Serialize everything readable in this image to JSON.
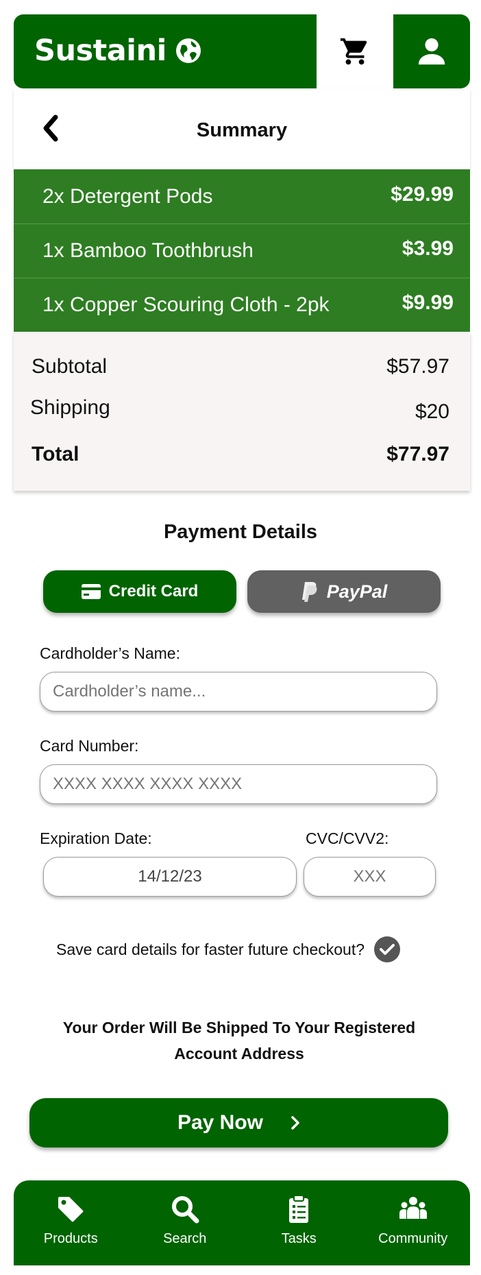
{
  "header": {
    "brand": "Sustaini",
    "brand_icon": "globe-icon",
    "cart_icon": "cart-icon",
    "profile_icon": "user-icon"
  },
  "summary": {
    "title": "Summary",
    "items": [
      {
        "name": "2x Detergent Pods",
        "price": "$29.99"
      },
      {
        "name": "1x Bamboo Toothbrush",
        "price": "$3.99"
      },
      {
        "name": "1x Copper Scouring Cloth - 2pk",
        "price": "$9.99"
      }
    ],
    "subtotal_label": "Subtotal",
    "subtotal_value": "$57.97",
    "shipping_label": "Shipping",
    "shipping_value": "$20",
    "total_label": "Total",
    "total_value": "$77.97"
  },
  "payment": {
    "title": "Payment Details",
    "credit_card_label": "Credit Card",
    "paypal_label": "PayPal",
    "cardholder_label": "Cardholder’s Name:",
    "cardholder_placeholder": "Cardholder’s name...",
    "card_number_label": "Card Number:",
    "card_number_placeholder": "XXXX XXXX XXXX XXXX",
    "expiry_label": "Expiration Date:",
    "expiry_value": "14/12/23",
    "cvc_label": "CVC/CVV2:",
    "cvc_placeholder": "XXX",
    "save_card_label": "Save card details for faster future checkout?"
  },
  "shipping_note": "Your Order Will Be Shipped To Your Registered Account Address",
  "pay_now_label": "Pay Now",
  "nav": {
    "items": [
      {
        "label": "Products",
        "icon": "tag-icon"
      },
      {
        "label": "Search",
        "icon": "search-icon"
      },
      {
        "label": "Tasks",
        "icon": "clipboard-icon"
      },
      {
        "label": "Community",
        "icon": "people-icon"
      }
    ]
  },
  "colors": {
    "primary_green": "#006400",
    "item_green": "#2e7d22",
    "paypal_gray": "#616161"
  }
}
